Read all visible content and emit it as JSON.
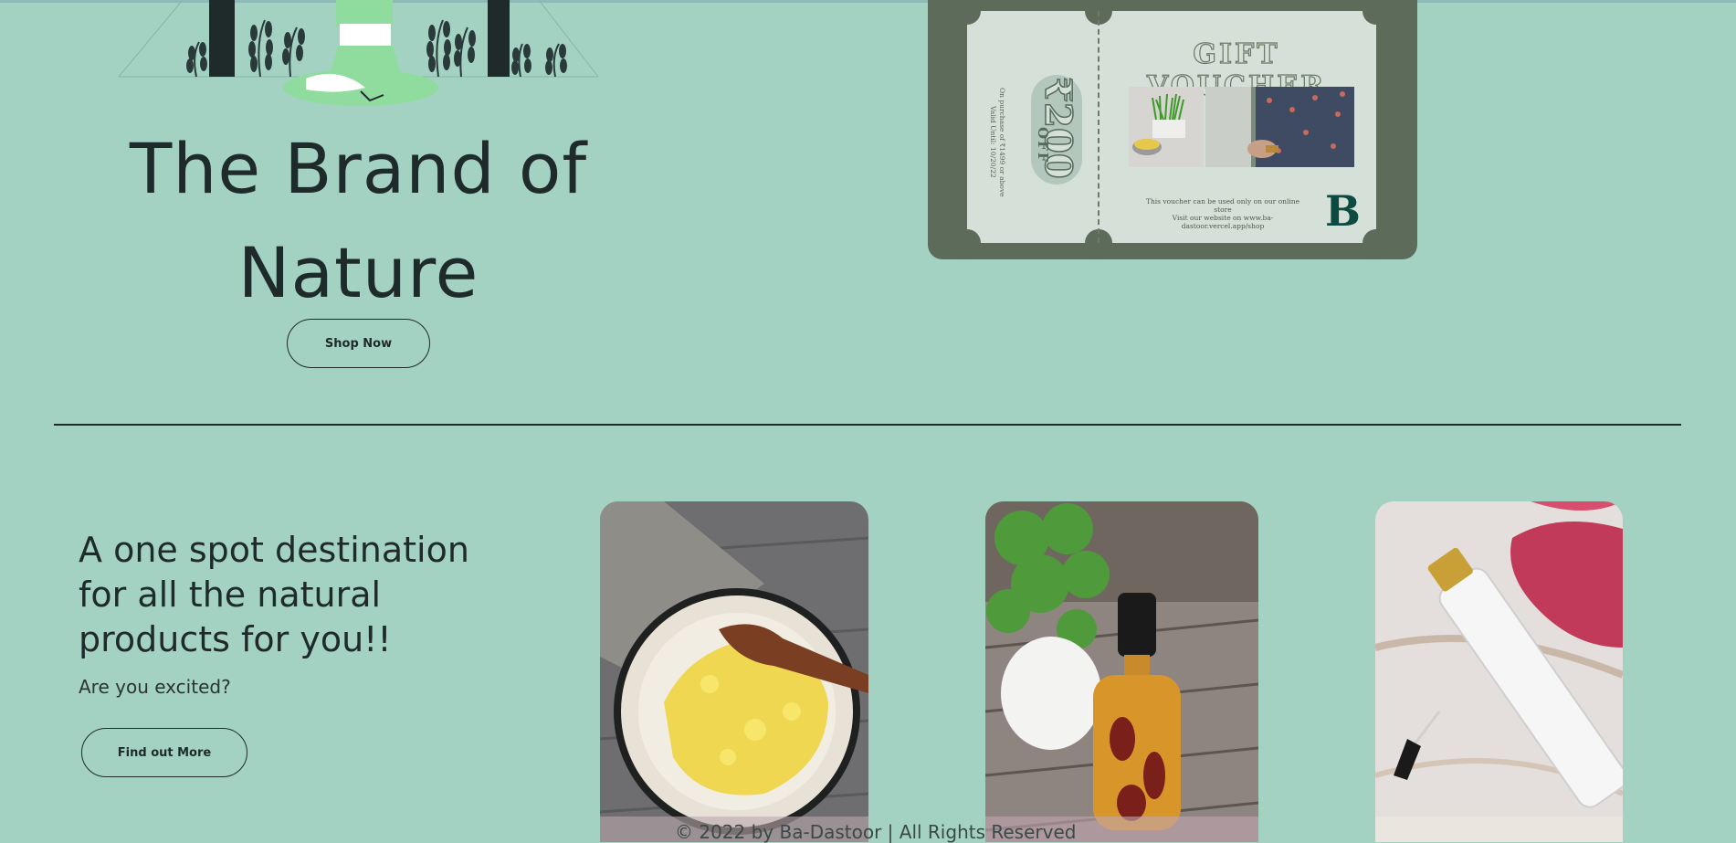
{
  "hero": {
    "title_line1": "The Brand of",
    "title_line2": "Nature",
    "shop_button": "Shop Now"
  },
  "voucher": {
    "title": "GIFT VOUCHER",
    "amount": "₹200",
    "off": "OFF",
    "condition": "On purchase of ₹1499 or above",
    "valid_until": "Valid Until: 10/20/22",
    "note_line1": "This voucher can be used only on our online store",
    "note_line2": "Visit our website on www.ba-dastoor.vercel.app/shop",
    "logo": "B"
  },
  "promo": {
    "heading": "A one spot destination for all the natural products for you!!",
    "subheading": "Are you excited?",
    "cta": "Find out More"
  },
  "products": [
    {
      "name": "besan-powder-bowl"
    },
    {
      "name": "oil-dropper-bottle"
    },
    {
      "name": "lily-serum-bottle"
    }
  ],
  "footer": {
    "copyright": "© 2022 by Ba-Dastoor | All Rights Reserved"
  },
  "colors": {
    "background": "#a3d2c2",
    "text": "#1f2a2a",
    "voucher_frame": "#5d6b5b",
    "voucher_card": "#d5e0d8"
  }
}
